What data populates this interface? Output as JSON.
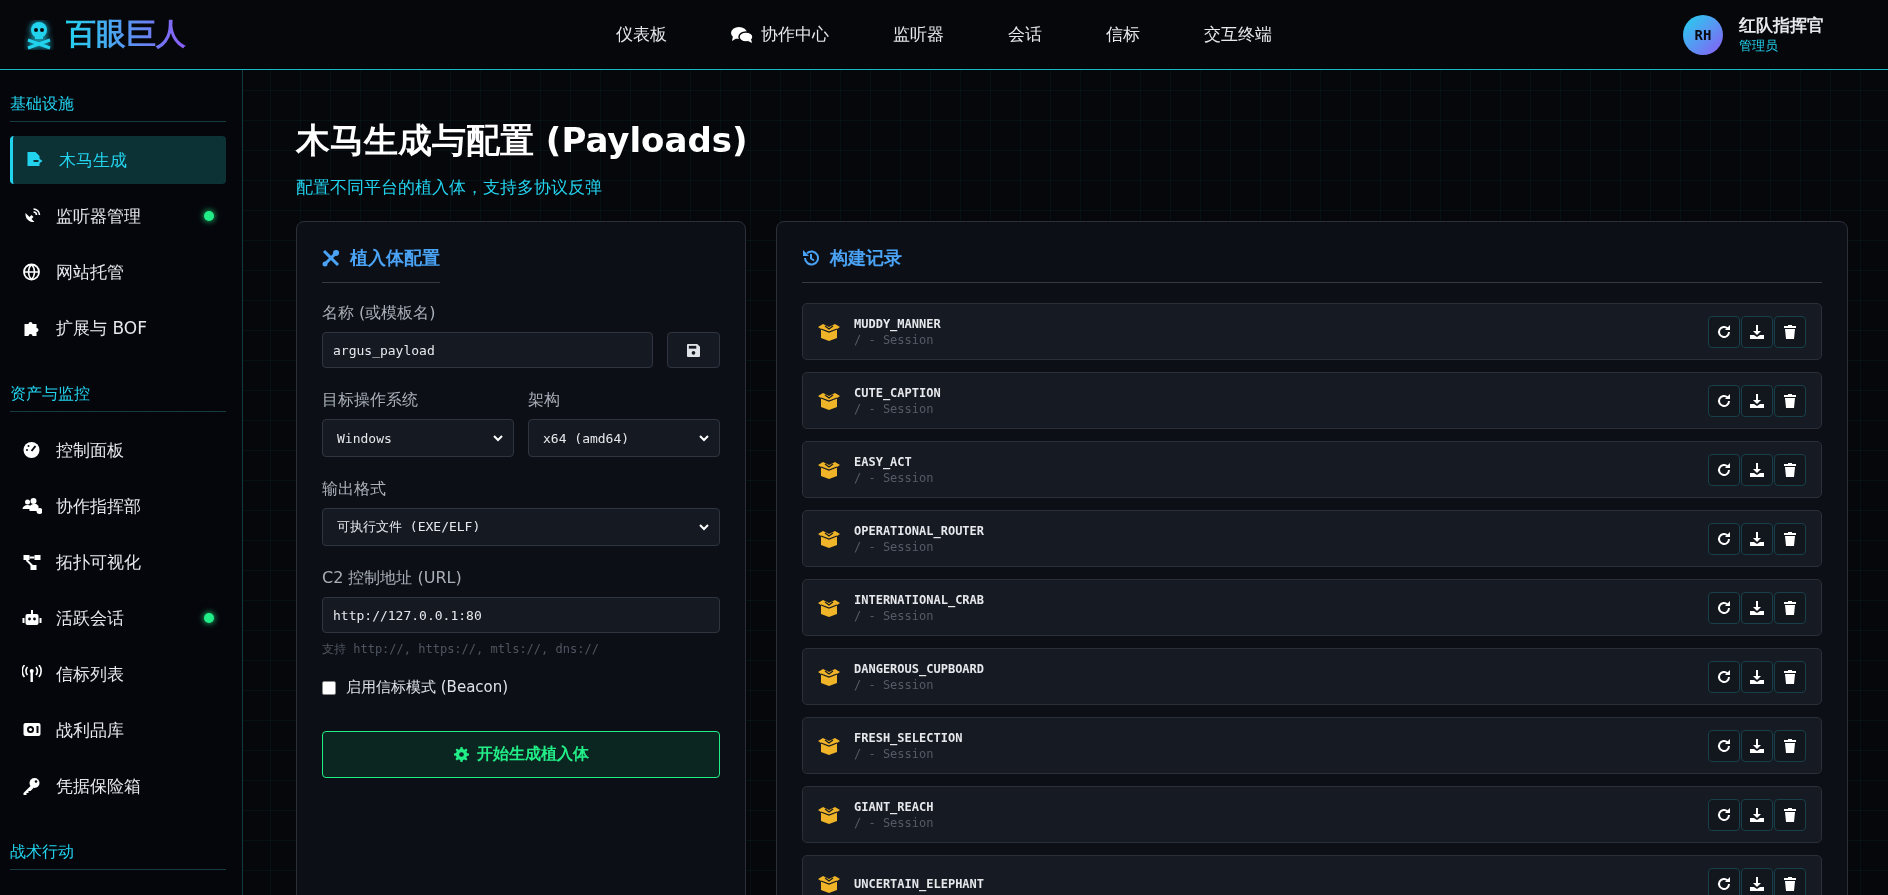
{
  "brand": {
    "name": "百眼巨人"
  },
  "nav": [
    {
      "label": "仪表板",
      "kind": "text"
    },
    {
      "label": "协作中心",
      "kind": "chat"
    },
    {
      "label": "监听器",
      "kind": "text"
    },
    {
      "label": "会话",
      "kind": "text"
    },
    {
      "label": "信标",
      "kind": "text"
    },
    {
      "label": "交互终端",
      "kind": "text"
    }
  ],
  "user": {
    "initials": "RH",
    "name": "红队指挥官",
    "role": "管理员"
  },
  "sidebar": [
    {
      "heading": "基础设施",
      "items": [
        {
          "label": "木马生成",
          "selected": true,
          "online": false
        },
        {
          "label": "监听器管理",
          "selected": false,
          "online": true
        },
        {
          "label": "网站托管",
          "selected": false,
          "online": false
        },
        {
          "label": "扩展与 BOF",
          "selected": false,
          "online": false
        }
      ]
    },
    {
      "heading": "资产与监控",
      "items": [
        {
          "label": "控制面板",
          "selected": false,
          "online": false
        },
        {
          "label": "协作指挥部",
          "selected": false,
          "online": false
        },
        {
          "label": "拓扑可视化",
          "selected": false,
          "online": false
        },
        {
          "label": "活跃会话",
          "selected": false,
          "online": true
        },
        {
          "label": "信标列表",
          "selected": false,
          "online": false
        },
        {
          "label": "战利品库",
          "selected": false,
          "online": false
        },
        {
          "label": "凭据保险箱",
          "selected": false,
          "online": false
        }
      ]
    },
    {
      "heading": "战术行动"
    }
  ],
  "page": {
    "title": "木马生成与配置 (Payloads)",
    "subtitle": "配置不同平台的植入体，支持多协议反弹"
  },
  "config": {
    "title": "植入体配置",
    "name_label": "名称 (或模板名)",
    "name_value": "argus_payload",
    "os_label": "目标操作系统",
    "os_value": "Windows",
    "arch_label": "架构",
    "arch_value": "x64 (amd64)",
    "format_label": "输出格式",
    "format_value": "可执行文件 (EXE/ELF)",
    "url_label": "C2 控制地址 (URL)",
    "url_value": "http://127.0.0.1:80",
    "url_hint": "支持 http://, https://, mtls://, dns://",
    "beacon_label": "启用信标模式 (Beacon)",
    "beacon_checked": false,
    "generate_button": "开始生成植入体"
  },
  "builds": {
    "title": "构建记录",
    "rows": [
      {
        "name": "MUDDY_MANNER",
        "meta": "/ - Session"
      },
      {
        "name": "CUTE_CAPTION",
        "meta": "/ - Session"
      },
      {
        "name": "EASY_ACT",
        "meta": "/ - Session"
      },
      {
        "name": "OPERATIONAL_ROUTER",
        "meta": "/ - Session"
      },
      {
        "name": "INTERNATIONAL_CRAB",
        "meta": "/ - Session"
      },
      {
        "name": "DANGEROUS_CUPBOARD",
        "meta": "/ - Session"
      },
      {
        "name": "FRESH_SELECTION",
        "meta": "/ - Session"
      },
      {
        "name": "GIANT_REACH",
        "meta": "/ - Session"
      },
      {
        "name": "UNCERTAIN_ELEPHANT"
      }
    ]
  }
}
